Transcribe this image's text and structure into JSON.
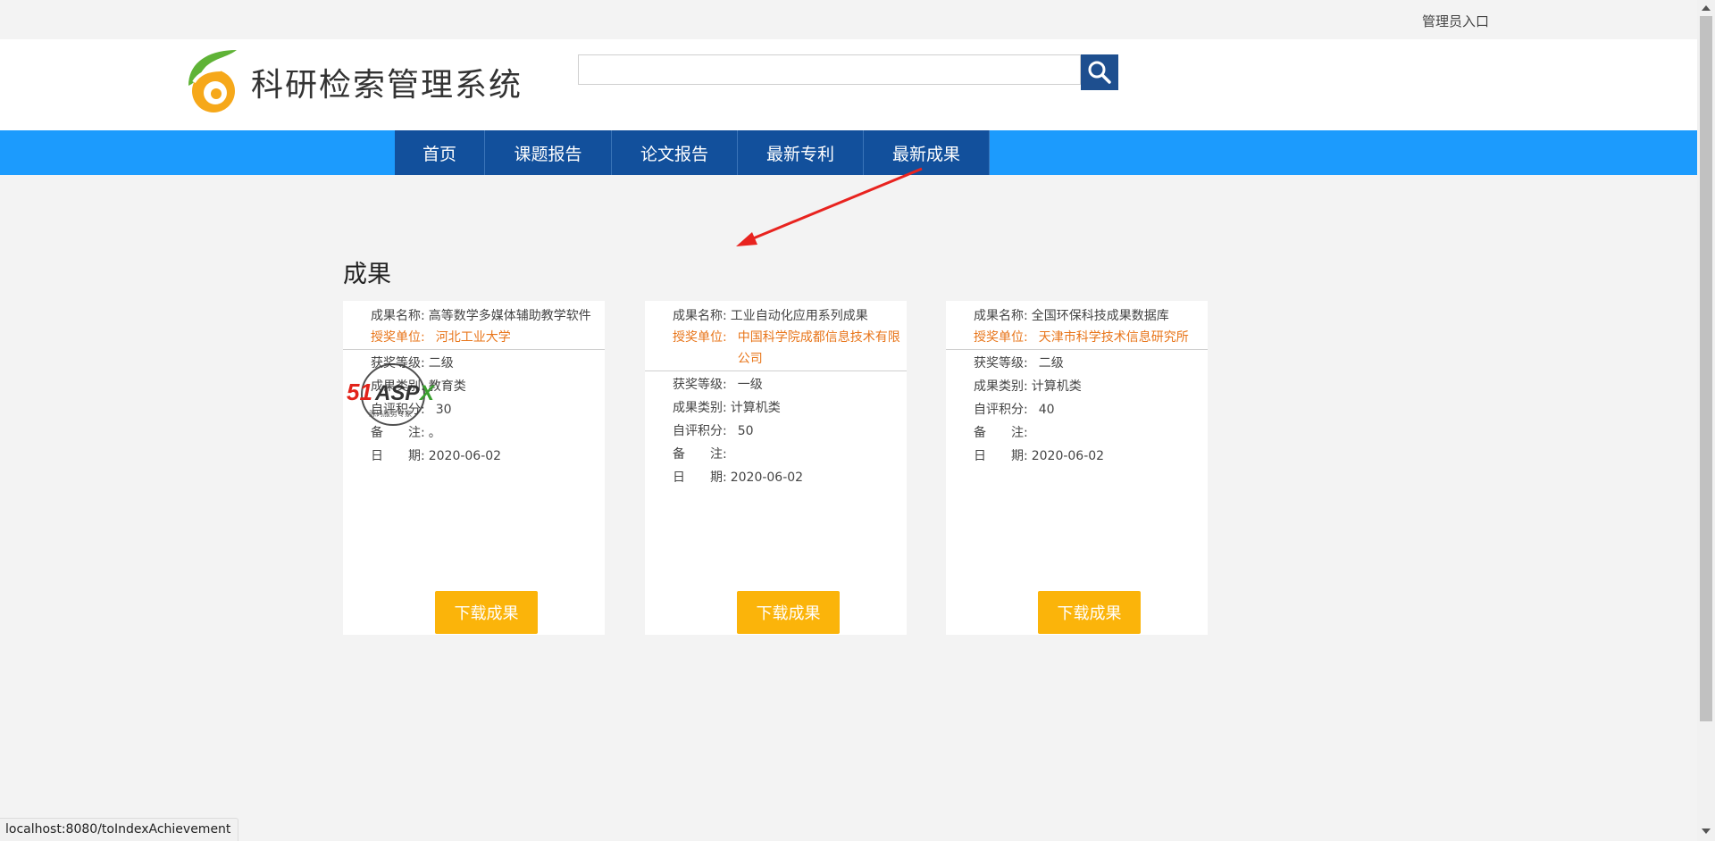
{
  "topbar": {
    "admin_link": "管理员入口"
  },
  "header": {
    "logo_text": "科研检索管理系统",
    "search_placeholder": ""
  },
  "nav": {
    "items": [
      {
        "label": "首页"
      },
      {
        "label": "课题报告"
      },
      {
        "label": "论文报告"
      },
      {
        "label": "最新专利"
      },
      {
        "label": "最新成果"
      }
    ]
  },
  "section": {
    "title": "成果"
  },
  "labels": {
    "name": "成果名称:",
    "unit": "授奖单位:",
    "level": "获奖等级:",
    "category": "成果类别:",
    "score": "自评积分:",
    "note": "备　　注:",
    "date": "日　　期:",
    "download": "下载成果"
  },
  "cards": [
    {
      "name": "高等数学多媒体辅助教学软件",
      "unit": "河北工业大学",
      "level": "二级",
      "category": "教育类",
      "score": "30",
      "note": "。",
      "date": "2020-06-02"
    },
    {
      "name": "工业自动化应用系列成果",
      "unit": "中国科学院成都信息技术有限公司",
      "level": "一级",
      "category": "计算机类",
      "score": "50",
      "note": "",
      "date": "2020-06-02"
    },
    {
      "name": "全国环保科技成果数据库",
      "unit": "天津市科学技术信息研究所",
      "level": "二级",
      "category": "计算机类",
      "score": "40",
      "note": "",
      "date": "2020-06-02"
    }
  ],
  "watermark": {
    "text": "51ASPX",
    "subtext": "源码服务专家"
  },
  "statusbar": {
    "url": "localhost:8080/toIndexAchievement"
  },
  "colors": {
    "nav_bg": "#1c9bfd",
    "nav_item": "#12509c",
    "button": "#fbb40a",
    "accent_orange": "#e8751a",
    "search_btn": "#1e4f8f"
  }
}
